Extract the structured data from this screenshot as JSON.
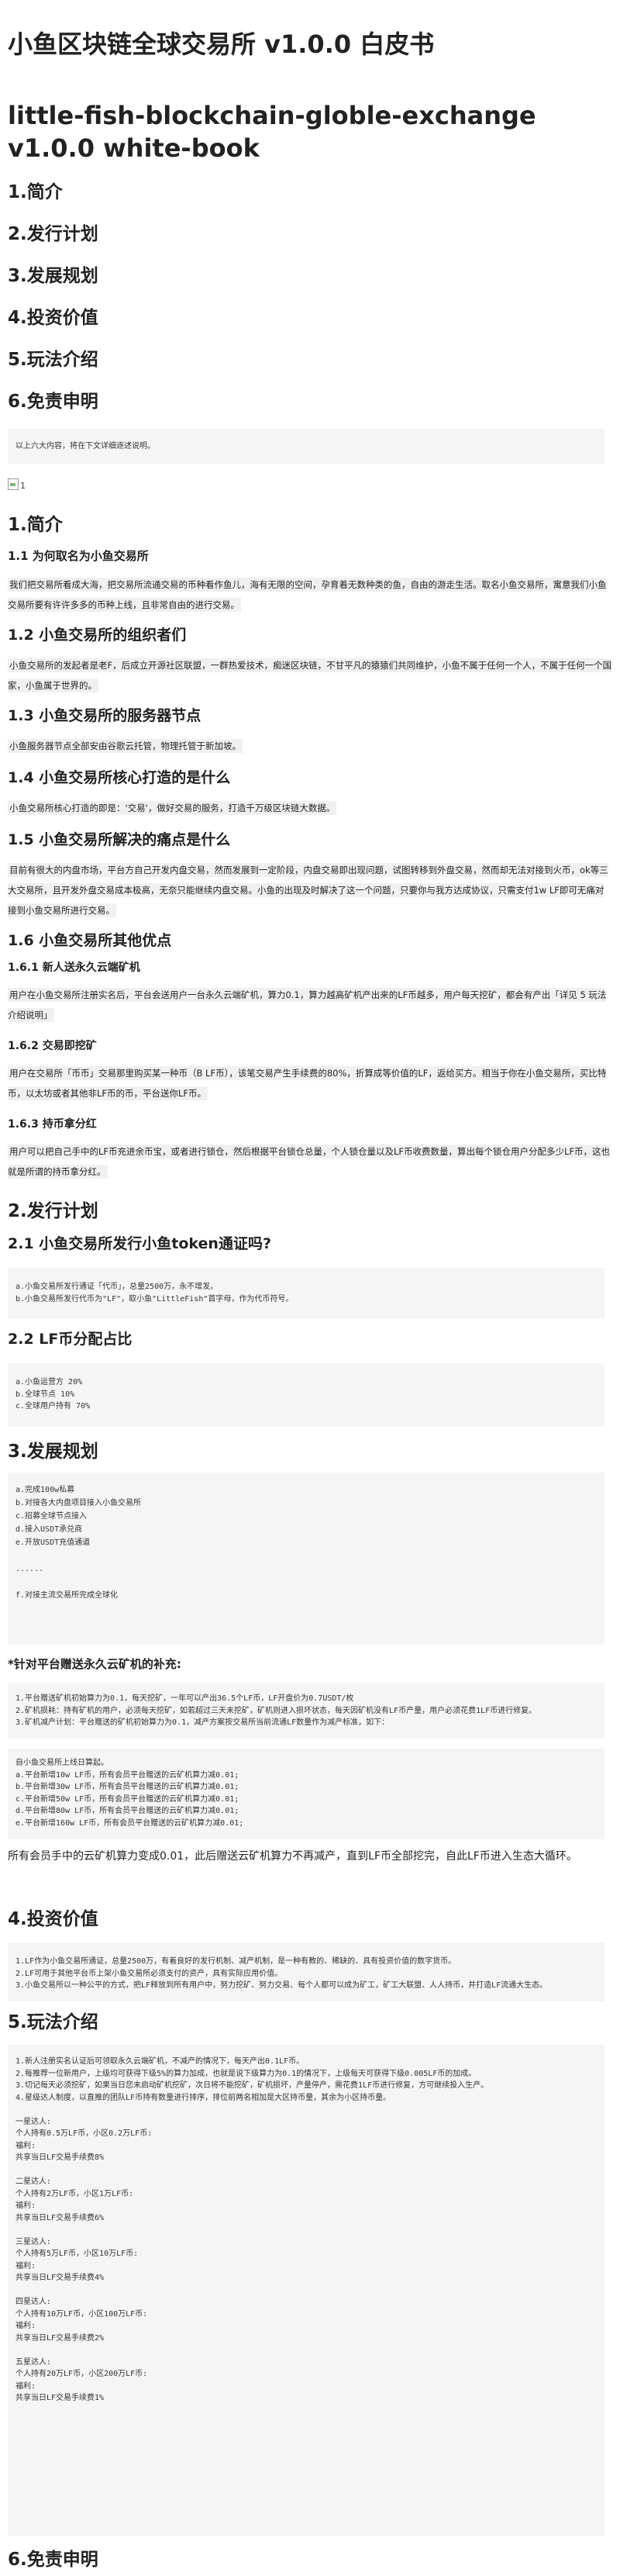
{
  "title": "小鱼区块链全球交易所 v1.0.0 白皮书",
  "title_en": "little-fish-blockchain-globle-exchange v1.0.0 white-book",
  "toc": [
    "1.简介",
    "2.发行计划",
    "3.发展规划",
    "4.投资价值",
    "5.玩法介绍",
    "6.免责申明"
  ],
  "toc_note": "以上六大内容，将在下文详细逐述说明。",
  "image_alt": "1",
  "intro": {
    "heading": "1.简介",
    "s11": {
      "heading": "1.1 为何取名为小鱼交易所",
      "text": "我们把交易所看成大海，把交易所流通交易的币种看作鱼儿，海有无限的空间，孕育着无数种类的鱼，自由的游走生活。取名小鱼交易所，寓意我们小鱼交易所要有许许多多的币种上线，且非常自由的进行交易。"
    },
    "s12": {
      "heading": "1.2 小鱼交易所的组织者们",
      "text": "小鱼交易所的发起者是老F，后成立开源社区联盟，一群热爱技术，痴迷区块链，不甘平凡的猿猿们共同维护，小鱼不属于任何一个人，不属于任何一个国家，小鱼属于世界的。"
    },
    "s13": {
      "heading": "1.3 小鱼交易所的服务器节点",
      "text": "小鱼服务器节点全部安由谷歌云托管，物理托管于新加坡。"
    },
    "s14": {
      "heading": "1.4 小鱼交易所核心打造的是什么",
      "text": "小鱼交易所核心打造的即是：'交易'，做好交易的服务，打造千万级区块链大数据。"
    },
    "s15": {
      "heading": "1.5 小鱼交易所解决的痛点是什么",
      "text": "目前有很大的内盘市场，平台方自己开发内盘交易，然而发展到一定阶段，内盘交易即出现问题，试图转移到外盘交易，然而却无法对接到火币，ok等三大交易所，且开发外盘交易成本极高，无奈只能继续内盘交易。小鱼的出现及时解决了这一个问题，只要你与我方达成协议，只需支付1w LF即可无痛对接到小鱼交易所进行交易。"
    },
    "s16": {
      "heading": "1.6 小鱼交易所其他优点",
      "sub1": {
        "heading": "1.6.1 新人送永久云端矿机",
        "text": "用户在小鱼交易所注册实名后，平台会送用户一台永久云端矿机，算力0.1，算力越高矿机产出来的LF币越多，用户每天挖矿，都会有产出「详见 5 玩法介绍说明」"
      },
      "sub2": {
        "heading": "1.6.2 交易即挖矿",
        "text": "用户在交易所「币币」交易那里购买某一种币（B LF币），该笔交易产生手续费的80%，折算成等价值的LF，返给买方。相当于你在小鱼交易所，买比特币，以太坊或者其他非LF币的币，平台送你LF币。"
      },
      "sub3": {
        "heading": "1.6.3 持币拿分红",
        "text": "用户可以把自己手中的LF币充进余币宝，或者进行锁仓，然后根据平台锁仓总量，个人锁仓量以及LF币收费数量，算出每个锁仓用户分配多少LF币，这也就是所谓的持币拿分红。"
      }
    }
  },
  "issue": {
    "heading": "2.发行计划",
    "s21": {
      "heading": "2.1 小鱼交易所发行小鱼token通证吗?",
      "code": "a.小鱼交易所发行通证「代币」，总量2500万，永不增发。\nb.小鱼交易所发行代币为\"LF\"，取小鱼\"LittleFish\"首字母，作为代币符号。"
    },
    "s22": {
      "heading": "2.2 LF币分配占比",
      "code": "a.小鱼运营方 20%\nb.全球节点 10%\nc.全球用户持有 70%"
    }
  },
  "dev": {
    "heading": "3.发展规划",
    "code": "a.完成100w私募\nb.对接各大内盘项目接入小鱼交易所\nc.招募全球节点接入\nd.接入USDT承兑商\ne.开放USDT充值通道\n\n......\n\nf.对接主流交易所完成全球化",
    "miner_heading": "*针对平台赠送永久云矿机的补充:",
    "code2": "1.平台赠送矿机初始算力为0.1，每天挖矿，一年可以产出36.5个LF币，LF开盘价为0.7USDT/枚\n2.矿机损耗：持有矿机的用户，必须每天挖矿，如若超过三天未挖矿，矿机则进入损坏状态，每天因矿机没有LF币产量，用户必须花费1LF币进行修复。\n3.矿机减产计划：平台赠送的矿机初始算力为0.1，减产方案按交易所当前流通LF数量作为减产标准，如下：",
    "code3": "自小鱼交易所上线日算起。\na.平台新增10w LF币，所有会员平台赠送的云矿机算力减0.01;\nb.平台新增30w LF币，所有会员平台赠送的云矿机算力减0.01;\nc.平台新增50w LF币，所有会员平台赠送的云矿机算力减0.01;\nd.平台新增80w LF币，所有会员平台赠送的云矿机算力减0.01;\ne.平台新增160w LF币，所有会员平台赠送的云矿机算力减0.01;",
    "plain": "所有会员手中的云矿机算力变成0.01，此后赠送云矿机算力不再减产，直到LF币全部挖完，自此LF币进入生态大循环。"
  },
  "invest": {
    "heading": "4.投资价值",
    "code": "1.LF作为小鱼交易所通证，总量2500万，有着良好的发行机制、减产机制，是一种有教的、稀缺的、具有投资价值的数字货币。\n2.LF可用于其他平台币上架小鱼交易所必须支付的资产，具有实际应用价值。\n3.小鱼交易所以一种公平的方式，把LF释放到所有用户中，努力挖矿、努力交易、每个人都可以成为矿工，矿工大联盟、人人持币，并打造LF流通大生态。"
  },
  "play": {
    "heading": "5.玩法介绍",
    "code": "1.新人注册实名认证后可领取永久云端矿机，不减产的情况下，每天产出0.1LF币。\n2.每推荐一位新用户，上级均可获得下级5%的算力加成，也就是说下级算力为0.1的情况下，上级每天可获得下级0.005LF币的加成。\n3.切记每天必须挖矿，如果当日您未启动矿机挖矿，次日将不能挖矿，矿机损坏，产量停产，需花费1LF币进行修复，方可继续投入生产。\n4.星级达人制度，以直推的团队LF币持有数量进行排序，排位前两名相加是大区持币量，其余为小区持币量。\n\n一星达人:\n个人持有0.5万LF币，小区0.2万LF币:\n福利:\n共享当日LF交易手续费8%\n\n二星达人:\n个人持有2万LF币，小区1万LF币:\n福利:\n共享当日LF交易手续费6%\n\n三星达人:\n个人持有5万LF币，小区10万LF币:\n福利:\n共享当日LF交易手续费4%\n\n四星达人:\n个人持有10万LF币，小区100万LF币:\n福利:\n共享当日LF交易手续费2%\n\n五星达人:\n个人持有20万LF币，小区200万LF币:\n福利:\n共享当日LF交易手续费1%"
  },
  "disclaimer": {
    "heading": "6.免责申明"
  }
}
